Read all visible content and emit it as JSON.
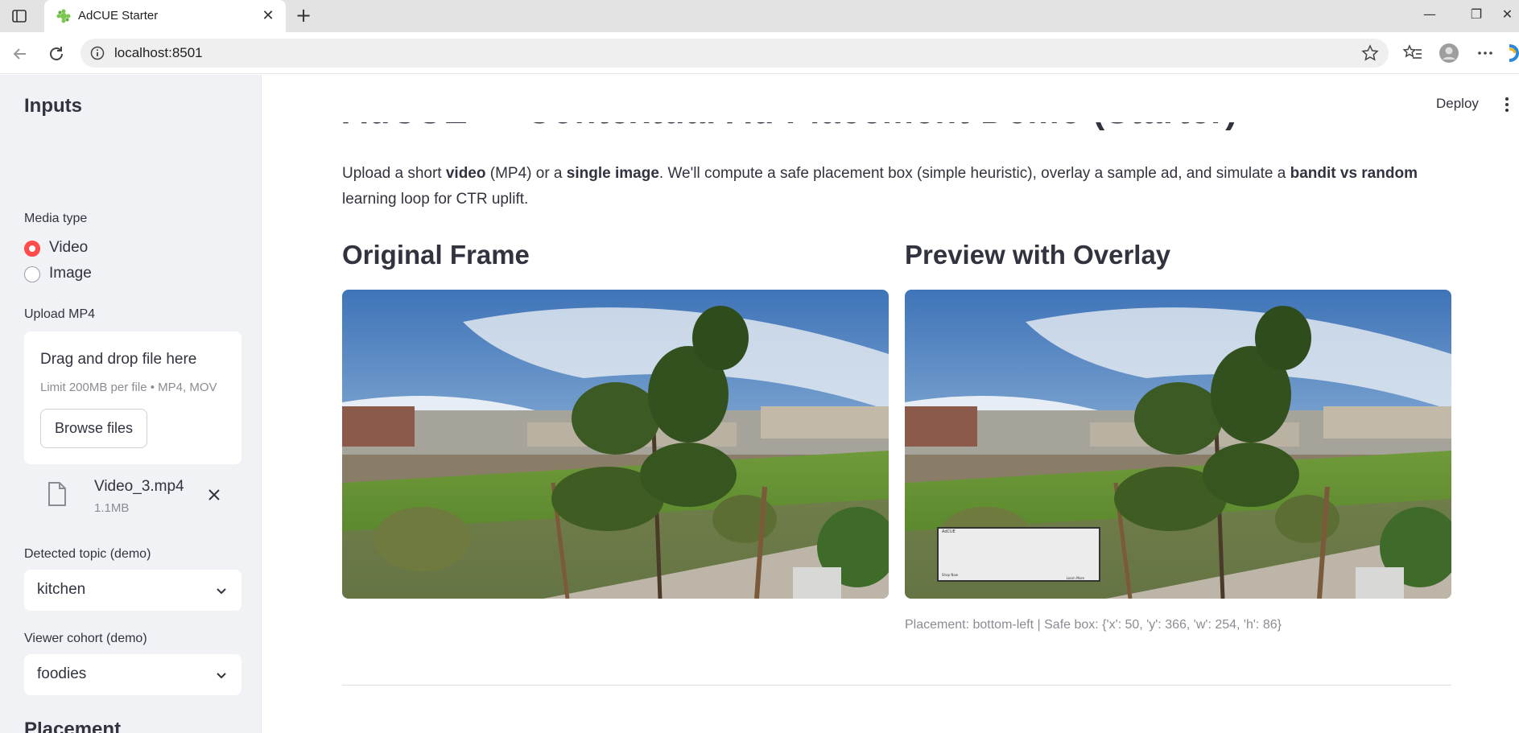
{
  "browser": {
    "tab_title": "AdCUE Starter",
    "url": "localhost:8501"
  },
  "sidebar": {
    "heading": "Inputs",
    "media_type": {
      "label": "Media type",
      "options": [
        "Video",
        "Image"
      ],
      "selected": "Video"
    },
    "upload": {
      "label": "Upload MP4",
      "drop_text": "Drag and drop file here",
      "limit_text": "Limit 200MB per file • MP4, MOV",
      "browse_label": "Browse files",
      "file_name": "Video_3.mp4",
      "file_size": "1.1MB"
    },
    "topic": {
      "label": "Detected topic (demo)",
      "value": "kitchen"
    },
    "cohort": {
      "label": "Viewer cohort (demo)",
      "value": "foodies"
    },
    "next_heading_partial": "Placement"
  },
  "main": {
    "deploy_label": "Deploy",
    "title_partial": "AdCUE — Contextual Ad Placement Demo (Starter)",
    "intro": {
      "p1": "Upload a short ",
      "b1": "video",
      "p2": " (MP4) or a ",
      "b2": "single image",
      "p3": ". We'll compute a safe placement box (simple heuristic), overlay a sample ad, and simulate a ",
      "b3": "bandit vs random",
      "p4": " learning loop for CTR uplift."
    },
    "original_heading": "Original Frame",
    "preview_heading": "Preview with Overlay",
    "placement_caption": "Placement: bottom-left | Safe box: {'x': 50, 'y': 366, 'w': 254, 'h': 86}",
    "overlay_ad": {
      "title_text": "AdCUE",
      "footer_left": "Shop Now",
      "footer_right": "Learn More"
    }
  },
  "colors": {
    "accent": "#ff4b4b",
    "sidebar_bg": "#f0f2f6",
    "text": "#31333f",
    "muted": "#8a8c94"
  }
}
